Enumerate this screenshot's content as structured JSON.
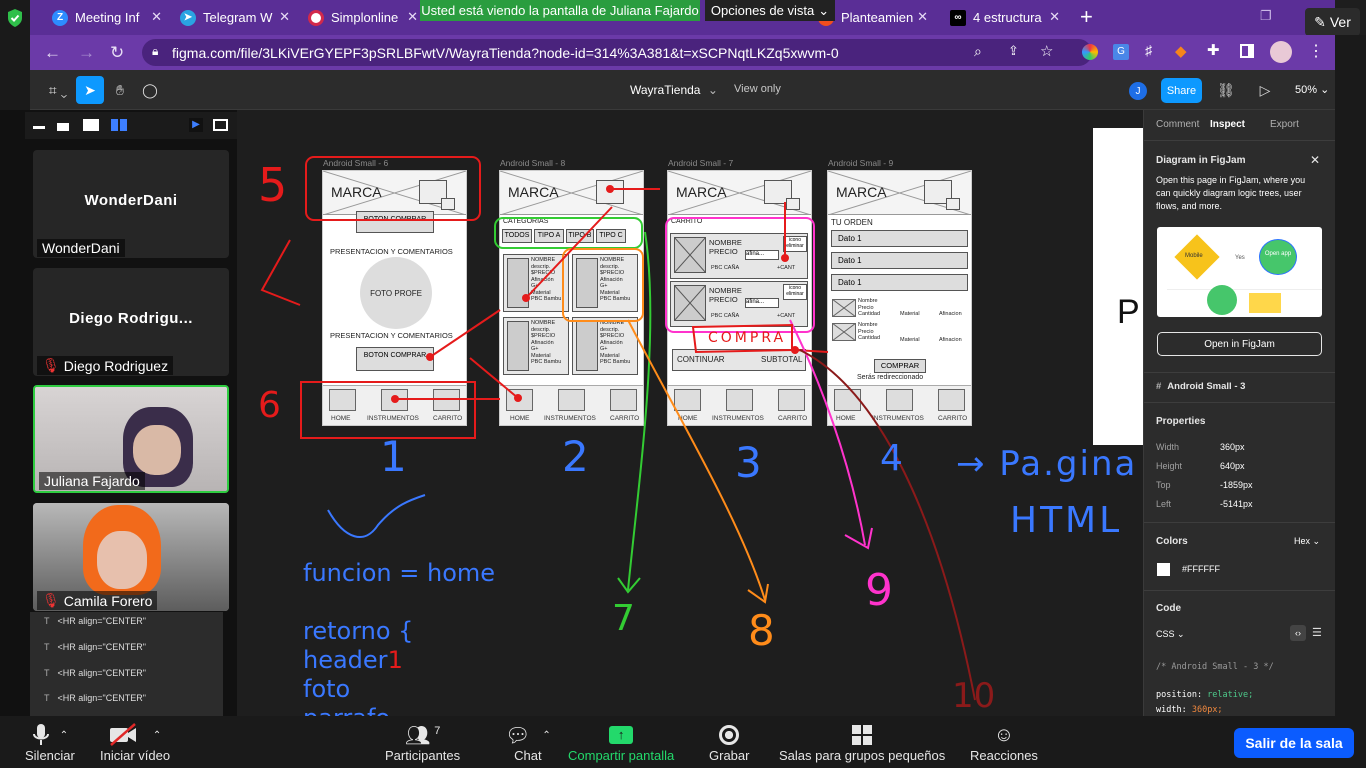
{
  "browser": {
    "tabs": [
      {
        "label": "Meeting Inf",
        "icon": "zoom-icon",
        "color": "#2d8cff"
      },
      {
        "label": "Telegram W",
        "icon": "telegram-icon",
        "color": "#2aa3e2"
      },
      {
        "label": "Simplonline",
        "icon": "simplon-icon",
        "color": "#d2294b"
      },
      {
        "label": "Planteamien",
        "icon": "figma-icon",
        "color": "#f24e1e"
      },
      {
        "label": "4 estructura",
        "icon": "infinity-icon",
        "color": "#000000"
      }
    ],
    "share_banner": "Usted está viendo la pantalla de Juliana Fajardo",
    "view_options": "Opciones de vista",
    "ver_button": "Ver",
    "url": "figma.com/file/3LKiVErGYEPF3pSRLBFwtV/WayraTienda?node-id=314%3A381&t=xSCPNqtLKZq5xwvm-0"
  },
  "figma": {
    "file_name": "WayraTienda",
    "view_only": "View only",
    "avatar_initial": "J",
    "share": "Share",
    "zoom": "50%",
    "panel": {
      "tabs": [
        "Comment",
        "Inspect",
        "Export"
      ],
      "promo_title": "Diagram in FigJam",
      "promo_text_1": "Open this page in FigJam, where you",
      "promo_text_2": "can quickly diagram logic trees, user",
      "promo_text_3": "flows, and more.",
      "promo_mobile": "Mobile",
      "promo_yes": "Yes",
      "promo_openapp": "Open app",
      "promo_button": "Open in FigJam",
      "frame_name": "Android Small - 3",
      "properties_title": "Properties",
      "properties": [
        {
          "k": "Width",
          "v": "360px"
        },
        {
          "k": "Height",
          "v": "640px"
        },
        {
          "k": "Top",
          "v": "-1859px"
        },
        {
          "k": "Left",
          "v": "-5141px"
        }
      ],
      "colors_title": "Colors",
      "colors_mode": "Hex",
      "color_value": "#FFFFFF",
      "code_title": "Code",
      "code_lang": "CSS",
      "code_comment": "/* Android Small - 3 */",
      "code_line1_prop": "position:",
      "code_line1_val": "relative;",
      "code_line2_prop": "width:",
      "code_line2_val": "360px;"
    }
  },
  "frames": [
    {
      "label": "Android Small - 6",
      "marca": "MARCA",
      "btn_top": "BOTON COMPRAR",
      "section1": "PRESENTACION Y COMENTARIOS",
      "photo": "FOTO PROFE",
      "section2": "PRESENTACION Y COMENTARIOS",
      "btn_bottom": "BOTON COMPRAR",
      "nav": [
        "HOME",
        "INSTRUMENTOS",
        "CARRITO"
      ]
    },
    {
      "label": "Android Small - 8",
      "marca": "MARCA",
      "categories": "CATEGORIAS",
      "chips": [
        "TODOS",
        "TIPO A",
        "TIPO B",
        "TIPO C"
      ],
      "card_lines": [
        "NOMBRE",
        "descrip.",
        "$PRECIO",
        "Afinación",
        "G+",
        "Material",
        "PBC",
        "Bambu"
      ],
      "nav": [
        "HOME",
        "INSTRUMENTOS",
        "CARRITO"
      ]
    },
    {
      "label": "Android Small - 7",
      "marca": "MARCA",
      "cart": "CARRITO",
      "item_name": "NOMBRE",
      "item_price": "PRECIO",
      "tuning": "afina...",
      "material": "PBC  CAÑA",
      "qty": "+CANT",
      "icon_remove": "icono eliminar",
      "continue": "CONTINUAR",
      "subtotal": "SUBTOTAL",
      "nav": [
        "HOME",
        "INSTRUMENTOS",
        "CARRITO"
      ]
    },
    {
      "label": "Android Small - 9",
      "marca": "MARCA",
      "order": "TU ORDEN",
      "data_rows": [
        "Dato 1",
        "Dato 1",
        "Dato 1"
      ],
      "sum_name": "Nombre",
      "sum_price": "Precio",
      "sum_qty": "Cantidad",
      "sum_material": "Material",
      "sum_tuning": "Afinacion",
      "buy": "COMPRAR",
      "redirect": "Serás redireccionado",
      "nav": [
        "HOME",
        "INSTRUMENTOS",
        "CARRITO"
      ]
    }
  ],
  "annotations": {
    "n1": "1",
    "n2": "2",
    "n3": "3",
    "n4": "4",
    "n5": "5",
    "n6": "6",
    "n7": "7",
    "n8": "8",
    "n9": "9",
    "n10": "10",
    "arrow_paginas": "→ Pa.gina",
    "html": "HTML",
    "compra": "COMPRA",
    "code_1": "funcion = home",
    "code_2": "retorno {",
    "code_3": "header",
    "code_3_sup": "1",
    "code_4": "foto",
    "code_5": "parrafo"
  },
  "layers": [
    "<HR align=\"CENTER\"",
    "<HR align=\"CENTER\"",
    "<HR align=\"CENTER\"",
    "<HR align=\"CENTER\""
  ],
  "participants_tiles": [
    {
      "name": "WonderDani",
      "big": "WonderDani",
      "muted": false
    },
    {
      "name": "Diego Rodriguez",
      "big": "Diego Rodrigu...",
      "muted": true
    },
    {
      "name": "Juliana Fajardo",
      "muted": false
    },
    {
      "name": "Camila Forero",
      "muted": true
    }
  ],
  "zoom_bar": {
    "mute": "Silenciar",
    "video": "Iniciar vídeo",
    "participants": "Participantes",
    "participants_count": "7",
    "chat": "Chat",
    "share": "Compartir pantalla",
    "record": "Grabar",
    "rooms": "Salas para grupos pequeños",
    "reactions": "Reacciones",
    "leave": "Salir de la sala"
  },
  "colors": {
    "chrome_purple": "#5a2e96",
    "share_green": "#2a9d3f",
    "figma_blue": "#0d99ff",
    "zoom_blue": "#0b5cff",
    "active_speaker": "#2ecc40"
  }
}
